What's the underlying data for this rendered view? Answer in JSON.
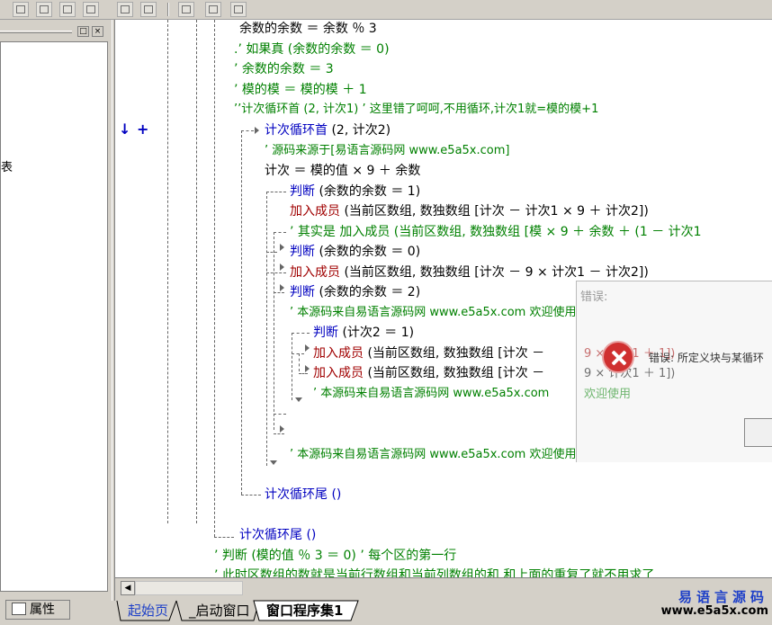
{
  "side_panel": {
    "partial_text": "表",
    "tab_label": "属性"
  },
  "gutter": {
    "down_arrow": "↓",
    "plus": "+"
  },
  "code": {
    "l1": "余数的余数 ＝ 余数 ％ 3",
    "l2": ".’ 如果真 (余数的余数 ＝ 0)",
    "l3": "’ 余数的余数 ＝ 3",
    "l4": "’ 模的模 ＝ 模的模 ＋ 1",
    "l5": "’’计次循环首 (2, 计次1) ’ 这里错了呵呵,不用循环,计次1就=模的模+1",
    "l6_kw": "计次循环首",
    "l6_rest": " (2, 计次2)",
    "l7": "’ 源码来源于[易语言源码网 www.e5a5x.com]",
    "l8": "计次 ＝ 模的值 × 9 ＋ 余数",
    "l9_kw": "判断",
    "l9_rest": " (余数的余数 ＝ 1)",
    "l10_fn": "加入成员",
    "l10_rest": " (当前区数组, 数独数组 [计次 － 计次1 × 9 ＋ 计次2])",
    "l11": "’ 其实是  加入成员 (当前区数组, 数独数组 [模 × 9 ＋ 余数 ＋ (1 － 计次1",
    "l12_kw": "判断",
    "l12_rest": " (余数的余数 ＝ 0)",
    "l13_fn": "加入成员",
    "l13_rest": " (当前区数组, 数独数组 [计次 － 9 × 计次1 － 计次2])",
    "l14_kw": "判断",
    "l14_rest": " (余数的余数 ＝ 2)",
    "l15": "’ 本源码来自易语言源码网 www.e5a5x.com  欢迎使用",
    "l16_kw": "判断",
    "l16_rest": " (计次2 ＝ 1)",
    "l17_fn": "加入成员",
    "l17_rest": " (当前区数组, 数独数组 [计次 －",
    "l17_tail": "9 × 计次1 ＋ 1])",
    "l18_fn": "加入成员",
    "l18_rest": " (当前区数组, 数独数组 [计次 －",
    "l18_tail": "9 × 计次1 ＋ 1])",
    "l19": "’ 本源码来自易语言源码网 www.e5a5x.com",
    "l19_tail": "欢迎使用",
    "l20": "’ 本源码来自易语言源码网 www.e5a5x.com  欢迎使用",
    "l21": "计次循环尾 ()",
    "l22": "计次循环尾 ()",
    "l23": "’ 判断 (模的值 ％ 3 ＝ 0) ’ 每个区的第一行",
    "l24": "’ 此时区数组的数就是当前行数组和当前列数组的和,和上面的重复了就不用求了"
  },
  "dialog": {
    "title": "错误:",
    "message": "错误: 所定义块与某循环"
  },
  "tabs": {
    "t1": "起始页",
    "t2": "_启动窗口",
    "t3": "窗口程序集1"
  },
  "brand": {
    "cn": "易语言源码",
    "url": "www.e5a5x.com"
  },
  "colors": {
    "comment": "#008000",
    "keyword": "#0000c0",
    "function": "#a00000",
    "brand": "#1e40c8"
  }
}
